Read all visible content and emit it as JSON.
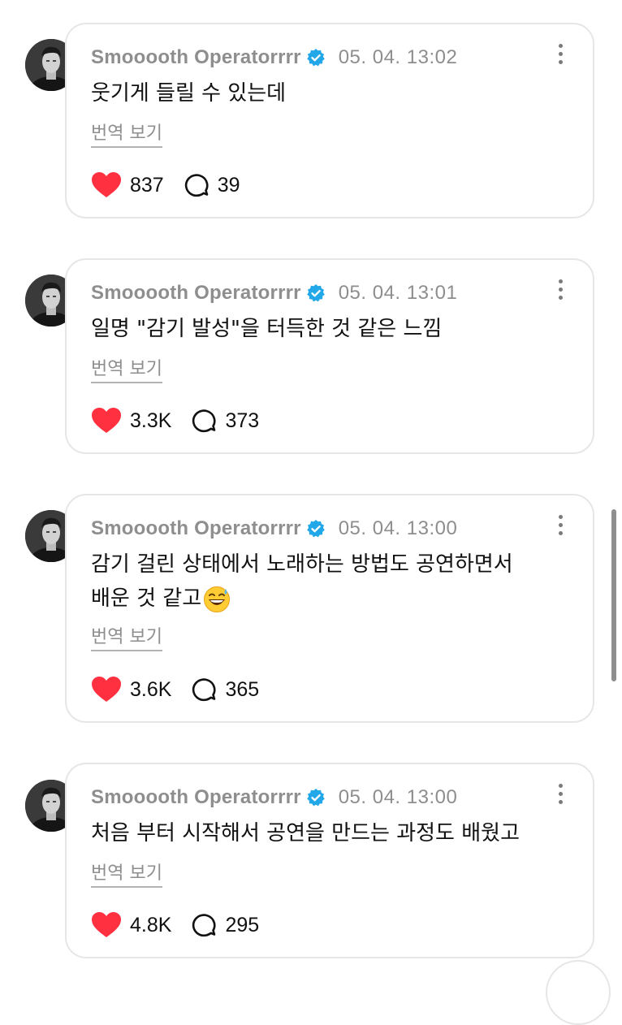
{
  "posts": [
    {
      "author": "Smooooth Operatorrrr",
      "time": "05. 04. 13:02",
      "lines": [
        "웃기게 들릴 수 있는데"
      ],
      "translate": "번역 보기",
      "likes": "837",
      "replies": "39"
    },
    {
      "author": "Smooooth Operatorrrr",
      "time": "05. 04. 13:01",
      "lines": [
        "일명 \"감기 발성\"을 터득한 것 같은 느낌"
      ],
      "translate": "번역 보기",
      "likes": "3.3K",
      "replies": "373"
    },
    {
      "author": "Smooooth Operatorrrr",
      "time": "05. 04. 13:00",
      "lines": [
        "감기 걸린 상태에서 노래하는 방법도 공연하면서",
        "배운 것 같고"
      ],
      "emoji": "grinning-face-with-sweat",
      "translate": "번역 보기",
      "likes": "3.6K",
      "replies": "365"
    },
    {
      "author": "Smooooth Operatorrrr",
      "time": "05. 04. 13:00",
      "lines": [
        "처음 부터 시작해서 공연을 만드는 과정도 배웠고"
      ],
      "translate": "번역 보기",
      "likes": "4.8K",
      "replies": "295"
    }
  ],
  "icons": {
    "verified": "verified-badge-icon",
    "like": "heart-icon",
    "reply": "reply-bubble-icon",
    "more": "more-vertical-icon"
  },
  "colors": {
    "heart": "#ff3040",
    "verified": "#0095f6",
    "meta_text": "#8e8e8e"
  }
}
